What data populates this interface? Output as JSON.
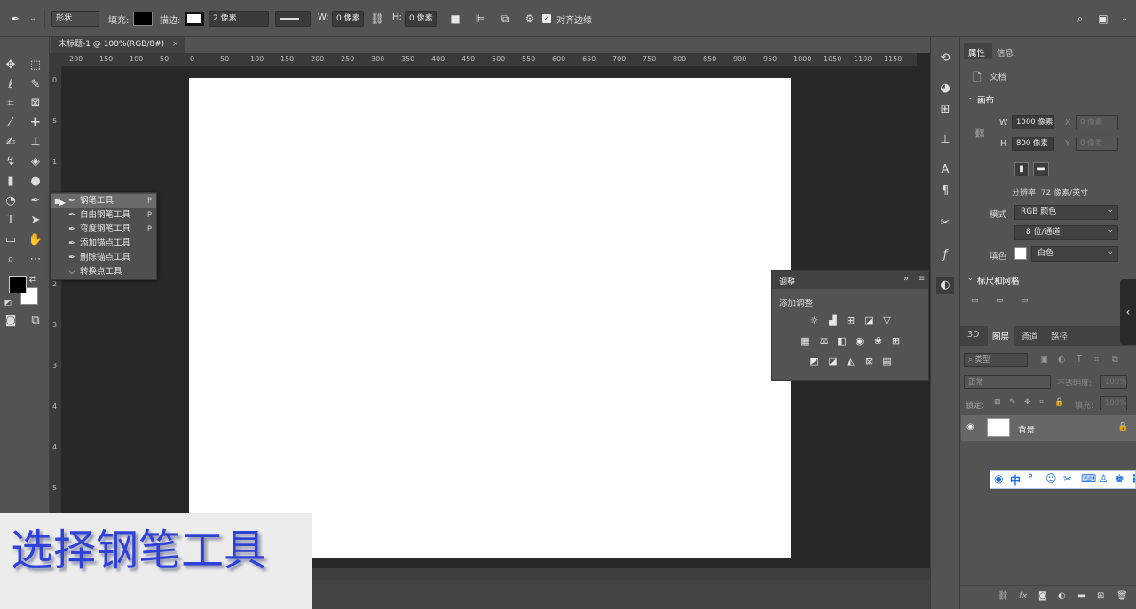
{
  "options_bar": {
    "mode_label": "形状",
    "fill_label": "填充:",
    "stroke_label": "描边:",
    "stroke_width": "2 像素",
    "w_label": "W:",
    "w_value": "0 像素",
    "h_label": "H:",
    "h_value": "0 像素",
    "align_edges_label": "对齐边缘"
  },
  "document": {
    "tab_title": "未标题-1 @ 100%(RGB/8#)",
    "close": "×"
  },
  "ruler": {
    "h_ticks": [
      "200",
      "150",
      "100",
      "50",
      "0",
      "50",
      "100",
      "150",
      "200",
      "250",
      "300",
      "350",
      "400",
      "450",
      "500",
      "550",
      "600",
      "650",
      "700",
      "750",
      "800",
      "850",
      "900",
      "950",
      "1000",
      "1050",
      "1100",
      "1150"
    ],
    "v_ticks": [
      "0",
      "5",
      "1",
      "1",
      "2",
      "2",
      "3",
      "3",
      "4",
      "4",
      "5",
      "5"
    ]
  },
  "pen_flyout": {
    "items": [
      {
        "label": "钢笔工具",
        "key": "P",
        "selected": true
      },
      {
        "label": "自由钢笔工具",
        "key": "P",
        "selected": false
      },
      {
        "label": "弯度钢笔工具",
        "key": "P",
        "selected": false
      },
      {
        "label": "添加锚点工具",
        "key": "",
        "selected": false
      },
      {
        "label": "删除锚点工具",
        "key": "",
        "selected": false
      },
      {
        "label": "转换点工具",
        "key": "",
        "selected": false
      }
    ]
  },
  "caption": {
    "text": "选择钢笔工具"
  },
  "adjustments": {
    "title": "调整",
    "subtitle": "添加调整"
  },
  "properties": {
    "tabs": [
      "属性",
      "信息"
    ],
    "doc_label": "文档",
    "canvas_section": "画布",
    "w_label": "W",
    "w_value": "1000 像素",
    "x_label": "X",
    "x_value": "0 像素",
    "h_label": "H",
    "h_value": "800 像素",
    "y_label": "Y",
    "y_value": "0 像素",
    "resolution": "分辨率: 72 像素/英寸",
    "mode_label": "模式",
    "mode_value": "RGB 颜色",
    "depth_value": "8 位/通道",
    "fill_label": "填色",
    "fill_value": "白色",
    "rulers_section": "标尺和网格"
  },
  "layers": {
    "tabs": [
      "3D",
      "图层",
      "通道",
      "路径"
    ],
    "filter_placeholder": "类型",
    "blend_mode": "正常",
    "opacity_label": "不透明度:",
    "opacity_value": "100%",
    "lock_label": "锁定:",
    "fill_label": "填充:",
    "fill_value": "100%",
    "layer_name": "背景"
  },
  "ime": {
    "lang": "中"
  }
}
